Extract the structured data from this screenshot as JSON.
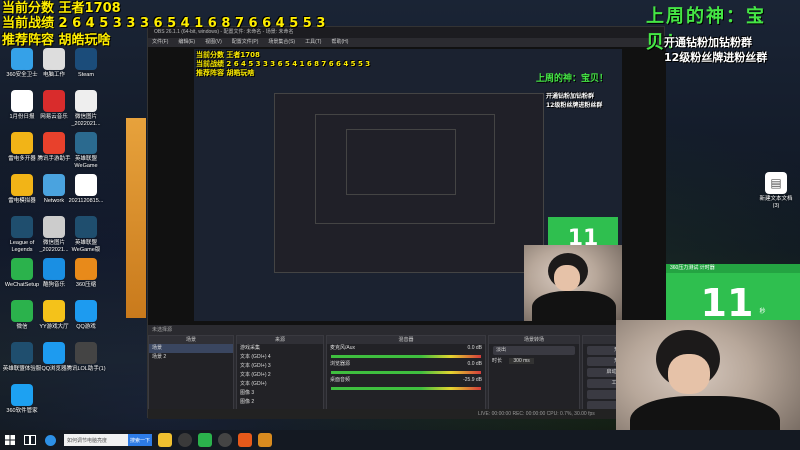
{
  "overlay": {
    "score_line": "当前分数 王者1708",
    "record_line": "当前战绩 2 6 4 5 3 3 3 6 5 4 1 6 8 7 6 6 4 5 5 3",
    "recommend_line": "推荐阵容 胡皓玩啥",
    "weekly_god": "上周的神：宝贝！",
    "promo_line1": "开通钻粉加钻粉群",
    "promo_line2": "12级粉丝牌进粉丝群"
  },
  "desktop_icons": [
    {
      "label": "360安全卫士",
      "icon": "shield-icon",
      "color": "#35a1e8"
    },
    {
      "label": "电脑工作",
      "icon": "computer-icon",
      "color": "#dddddd"
    },
    {
      "label": "Steam",
      "icon": "steam-icon",
      "color": "#1b4c7a"
    },
    {
      "label": "1月份日报",
      "icon": "document-icon",
      "color": "#ffffff"
    },
    {
      "label": "网易云音乐",
      "icon": "music-icon",
      "color": "#d92c2c"
    },
    {
      "label": "微信图片_2022021...",
      "icon": "image-icon",
      "color": "#eeeeee"
    },
    {
      "label": "雷电多开器",
      "icon": "emulator-icon",
      "color": "#f2b417"
    },
    {
      "label": "腾讯手游助手",
      "icon": "game-assistant-icon",
      "color": "#e8412c"
    },
    {
      "label": "英雄联盟WeGame",
      "icon": "lol-icon",
      "color": "#2b6a8f"
    },
    {
      "label": "雷电模拟器",
      "icon": "emulator-icon",
      "color": "#f2b417"
    },
    {
      "label": "Network",
      "icon": "globe-icon",
      "color": "#4aa3df"
    },
    {
      "label": "2021120815...",
      "icon": "document-icon",
      "color": "#ffffff"
    },
    {
      "label": "League of Legends",
      "icon": "lol-icon",
      "color": "#1f4e6e"
    },
    {
      "label": "微信图片_2022021...",
      "icon": "image-icon",
      "color": "#cccccc"
    },
    {
      "label": "英雄联盟 WeGame版",
      "icon": "lol-icon",
      "color": "#1f4e6e"
    },
    {
      "label": "WeChatSetup",
      "icon": "wechat-icon",
      "color": "#2bb24c"
    },
    {
      "label": "酷狗音乐",
      "icon": "kugou-icon",
      "color": "#1a8fe3"
    },
    {
      "label": "360压缩",
      "icon": "zip-icon",
      "color": "#e88a1a"
    },
    {
      "label": "微信",
      "icon": "wechat-icon",
      "color": "#2bb24c"
    },
    {
      "label": "YY游戏大厅",
      "icon": "yy-icon",
      "color": "#f4c21a"
    },
    {
      "label": "QQ游戏",
      "icon": "qq-icon",
      "color": "#1d9bf0"
    },
    {
      "label": "英雄联盟体验服",
      "icon": "lol-icon",
      "color": "#1f4e6e"
    },
    {
      "label": "QQ浏览器",
      "icon": "browser-icon",
      "color": "#1d9bf0"
    },
    {
      "label": "腾讯LOL助手(1)",
      "icon": "image-icon",
      "color": "#444444"
    },
    {
      "label": "360软件管家",
      "icon": "store-icon",
      "color": "#1da1f2"
    }
  ],
  "right_desktop_icon": {
    "label": "新建文本文档 (3)",
    "icon": "document-icon"
  },
  "obs": {
    "title": "OBS 26.1.1 (64-bit, windows) - 配置文件: 未命名 - 场景: 未命名",
    "menu": [
      "文件(F)",
      "编辑(E)",
      "视图(V)",
      "配置文件(P)",
      "场景集合(S)",
      "工具(T)",
      "帮助(H)"
    ],
    "source_panel_title": "未选择源",
    "docks": {
      "scenes": {
        "title": "场景",
        "items": [
          "场景",
          "场景 2"
        ]
      },
      "sources": {
        "title": "来源",
        "items": [
          "游戏采集",
          "文本 (GDI+) 4",
          "文本 (GDI+) 3",
          "文本 (GDI+) 2",
          "文本 (GDI+)",
          "图像 3",
          "图像 2"
        ]
      },
      "mixer": {
        "title": "混音器",
        "channels": [
          {
            "name": "麦克风/Aux",
            "db": "0.0 dB"
          },
          {
            "name": "浏览器源",
            "db": "0.0 dB"
          },
          {
            "name": "桌面音频",
            "db": "-25.9 dB"
          }
        ]
      },
      "transitions": {
        "title": "场景转场",
        "type": "淡出",
        "duration_label": "时长",
        "duration": "300 ms"
      },
      "controls": {
        "title": "控件",
        "buttons": [
          "开始直播",
          "开始录制",
          "启动虚拟摄像机",
          "工作室模式",
          "设置",
          "退出"
        ]
      }
    },
    "status": "LIVE: 00:00:00   REC: 00:00:00   CPU: 0.7%, 30.00 fps"
  },
  "timers": {
    "right": {
      "header": "360压力测试 计时器",
      "value": "11",
      "unit": "秒"
    },
    "preview": {
      "value": "11"
    }
  },
  "taskbar": {
    "search_placeholder": "如何调节电脑亮度",
    "search_button": "搜索一下"
  }
}
